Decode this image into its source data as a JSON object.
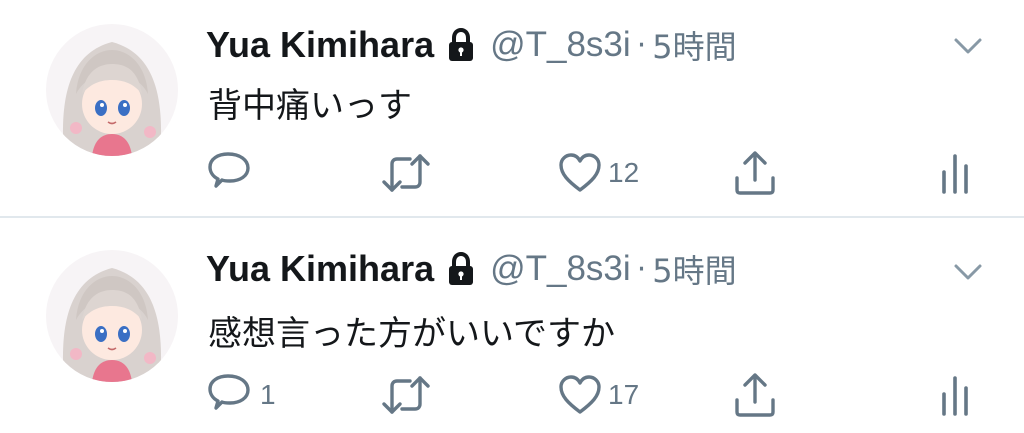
{
  "tweets": [
    {
      "name": "Yua Kimihara",
      "handle": "@T_8s3i",
      "separator": "·",
      "time": "5時間",
      "text": "背中痛いっす",
      "reply_count": "",
      "like_count": "12",
      "icons": [
        "reply-icon",
        "retweet-icon",
        "like-icon",
        "share-icon",
        "analytics-icon",
        "lock-icon",
        "caret-down-icon"
      ]
    },
    {
      "name": "Yua Kimihara",
      "handle": "@T_8s3i",
      "separator": "·",
      "time": "5時間",
      "text": "感想言った方がいいですか",
      "reply_count": "1",
      "like_count": "17",
      "icons": [
        "reply-icon",
        "retweet-icon",
        "like-icon",
        "share-icon",
        "analytics-icon",
        "lock-icon",
        "caret-down-icon"
      ]
    }
  ],
  "colors": {
    "text_primary": "#14171a",
    "text_secondary": "#657786",
    "divider": "#e1e8ed"
  }
}
